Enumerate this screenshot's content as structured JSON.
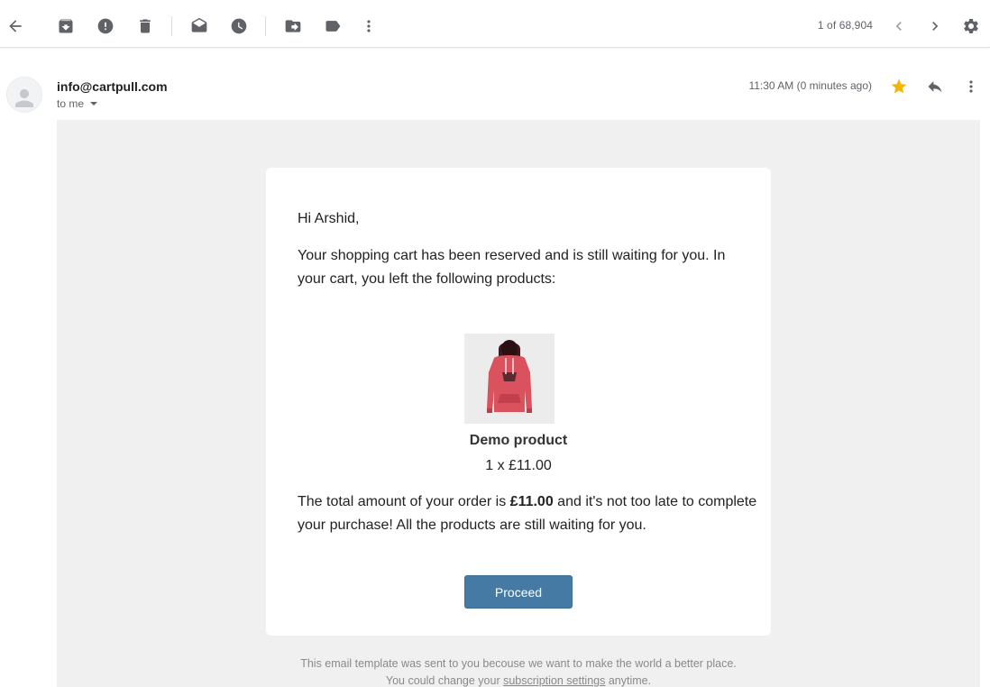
{
  "toolbar": {
    "page_count": "1 of 68,904"
  },
  "header": {
    "sender": "info@cartpull.com",
    "recipient": "to me",
    "timestamp": "11:30 AM (0 minutes ago)"
  },
  "email": {
    "greeting": "Hi Arshid,",
    "intro": "Your shopping cart has been reserved and is still waiting for you. In your cart, you left the following products:",
    "product": {
      "name": "Demo product",
      "quantity_price": "1 x £11.00",
      "image_icon": "hoodie-image"
    },
    "total_prefix": "The total amount of your order is ",
    "total_amount": "£11.00",
    "total_suffix": " and it's not too late to complete your purchase! All the products are still waiting for you.",
    "button_label": "Proceed",
    "footer_before": "This email template was sent to you becouse we want to make the world a better place. You could change your ",
    "footer_link": "subscription settings",
    "footer_after": " anytime."
  },
  "colors": {
    "button": "#457aa5",
    "star": "#f4b400",
    "email_background": "#f0f0f0"
  },
  "icons": [
    "back-arrow-icon",
    "archive-icon",
    "report-spam-icon",
    "delete-icon",
    "mark-unread-icon",
    "snooze-icon",
    "move-to-icon",
    "label-icon",
    "more-vert-icon",
    "chevron-left-icon",
    "chevron-right-icon",
    "settings-gear-icon",
    "star-icon",
    "reply-icon"
  ]
}
